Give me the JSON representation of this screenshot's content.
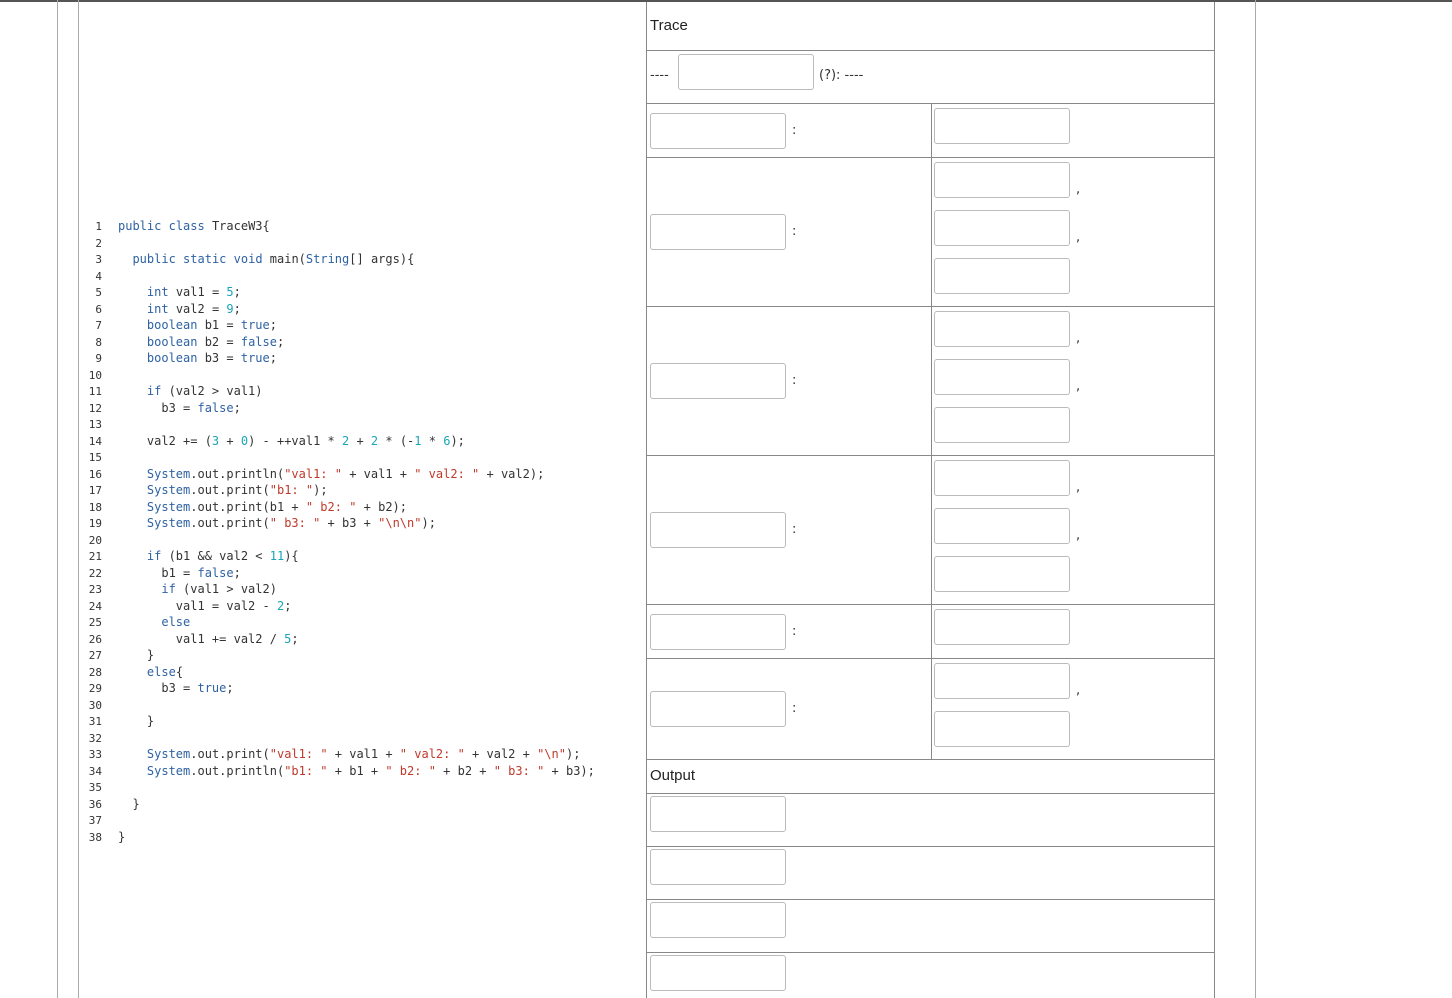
{
  "code": {
    "lines": [
      {
        "n": "1",
        "html": "<span class='kw'>public</span> <span class='kw'>class</span> TraceW3{"
      },
      {
        "n": "2",
        "html": ""
      },
      {
        "n": "3",
        "html": "  <span class='kw'>public</span> <span class='kw'>static</span> <span class='kw'>void</span> main(<span class='kw'>String</span>[] args){"
      },
      {
        "n": "4",
        "html": ""
      },
      {
        "n": "5",
        "html": "    <span class='kw'>int</span> val1 = <span class='num'>5</span>;"
      },
      {
        "n": "6",
        "html": "    <span class='kw'>int</span> val2 = <span class='num'>9</span>;"
      },
      {
        "n": "7",
        "html": "    <span class='kw'>boolean</span> b1 = <span class='kw'>true</span>;"
      },
      {
        "n": "8",
        "html": "    <span class='kw'>boolean</span> b2 = <span class='kw'>false</span>;"
      },
      {
        "n": "9",
        "html": "    <span class='kw'>boolean</span> b3 = <span class='kw'>true</span>;"
      },
      {
        "n": "10",
        "html": ""
      },
      {
        "n": "11",
        "html": "    <span class='kw'>if</span> (val2 &gt; val1)"
      },
      {
        "n": "12",
        "html": "      b3 = <span class='kw'>false</span>;"
      },
      {
        "n": "13",
        "html": ""
      },
      {
        "n": "14",
        "html": "    val2 += (<span class='num'>3</span> + <span class='num'>0</span>) - ++val1 * <span class='num'>2</span> + <span class='num'>2</span> * (-<span class='num'>1</span> * <span class='num'>6</span>);"
      },
      {
        "n": "15",
        "html": ""
      },
      {
        "n": "16",
        "html": "    <span class='kw'>System</span>.out.println(<span class='str'>\"val1: \"</span> + val1 + <span class='str'>\" val2: \"</span> + val2);"
      },
      {
        "n": "17",
        "html": "    <span class='kw'>System</span>.out.print(<span class='str'>\"b1: \"</span>);"
      },
      {
        "n": "18",
        "html": "    <span class='kw'>System</span>.out.print(b1 + <span class='str'>\" b2: \"</span> + b2);"
      },
      {
        "n": "19",
        "html": "    <span class='kw'>System</span>.out.print(<span class='str'>\" b3: \"</span> + b3 + <span class='str'>\"\\n\\n\"</span>);"
      },
      {
        "n": "20",
        "html": ""
      },
      {
        "n": "21",
        "html": "    <span class='kw'>if</span> (b1 &amp;&amp; val2 &lt; <span class='num'>11</span>){"
      },
      {
        "n": "22",
        "html": "      b1 = <span class='kw'>false</span>;"
      },
      {
        "n": "23",
        "html": "      <span class='kw'>if</span> (val1 &gt; val2)"
      },
      {
        "n": "24",
        "html": "        val1 = val2 - <span class='num'>2</span>;"
      },
      {
        "n": "25",
        "html": "      <span class='kw'>else</span>"
      },
      {
        "n": "26",
        "html": "        val1 += val2 / <span class='num'>5</span>;"
      },
      {
        "n": "27",
        "html": "    }"
      },
      {
        "n": "28",
        "html": "    <span class='kw'>else</span>{"
      },
      {
        "n": "29",
        "html": "      b3 = <span class='kw'>true</span>;"
      },
      {
        "n": "30",
        "html": ""
      },
      {
        "n": "31",
        "html": "    }"
      },
      {
        "n": "32",
        "html": ""
      },
      {
        "n": "33",
        "html": "    <span class='kw'>System</span>.out.print(<span class='str'>\"val1: \"</span> + val1 + <span class='str'>\" val2: \"</span> + val2 + <span class='str'>\"\\n\"</span>);"
      },
      {
        "n": "34",
        "html": "    <span class='kw'>System</span>.out.println(<span class='str'>\"b1: \"</span> + b1 + <span class='str'>\" b2: \"</span> + b2 + <span class='str'>\" b3: \"</span> + b3);"
      },
      {
        "n": "35",
        "html": ""
      },
      {
        "n": "36",
        "html": "  }"
      },
      {
        "n": "37",
        "html": ""
      },
      {
        "n": "38",
        "html": "}"
      }
    ]
  },
  "trace": {
    "title": "Trace",
    "header_prefix": "----",
    "header_suffix": "(?): ----",
    "header_input_value": "",
    "var_sep": ":",
    "val_sep": ",",
    "rows": [
      {
        "values": 1
      },
      {
        "values": 3
      },
      {
        "values": 3
      },
      {
        "values": 3
      },
      {
        "values": 1
      },
      {
        "values": 2
      }
    ]
  },
  "output": {
    "title": "Output",
    "lines": 4
  }
}
